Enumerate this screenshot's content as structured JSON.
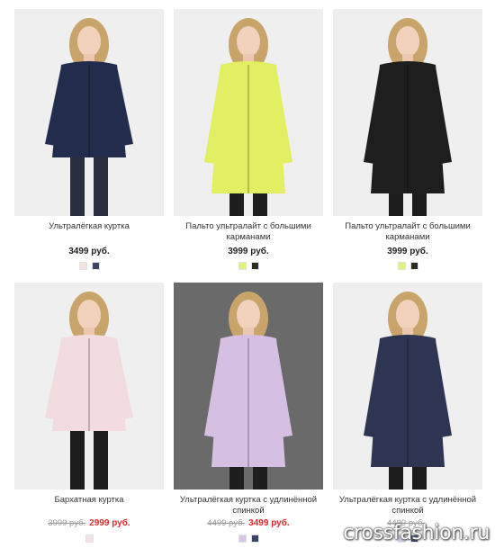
{
  "products": [
    {
      "title": "Ультралёгкая куртка",
      "price": "3499 руб.",
      "colors": [
        "#efe5e0",
        "#3b4466"
      ],
      "photo_bg": "#efefef",
      "garment": "#222c4d"
    },
    {
      "title": "Пальто ультралайт с большими карманами",
      "price": "3999 руб.",
      "colors": [
        "#e4f27a",
        "#2a2a2a"
      ],
      "photo_bg": "#efefef",
      "garment": "#e3ef63"
    },
    {
      "title": "Пальто ультралайт с большими карманами",
      "price": "3999 руб.",
      "colors": [
        "#e4f27a",
        "#2a2a2a"
      ],
      "photo_bg": "#efefef",
      "garment": "#1e1e1e"
    },
    {
      "title": "Бархатная куртка",
      "old_price": "3999 руб.",
      "new_price": "2999 руб.",
      "colors": [
        "#f4e3e5"
      ],
      "photo_bg": "#efefef",
      "garment": "#f2dcdf"
    },
    {
      "title": "Ультралёгкая куртка с удлинённой спинкой",
      "old_price": "4499 руб.",
      "new_price": "3499 руб.",
      "colors": [
        "#d8c6e6",
        "#3b4466"
      ],
      "photo_bg": "#6a6a6a",
      "garment": "#d5c0e3"
    },
    {
      "title": "Ультралёгкая куртка с удлинённой спинкой",
      "old_price": "4499 руб.",
      "new_price": "",
      "colors": [
        "#d8c6e6",
        "#3b4466"
      ],
      "photo_bg": "#efefef",
      "garment": "#2d3552"
    }
  ],
  "watermark": "crossfashion.ru"
}
